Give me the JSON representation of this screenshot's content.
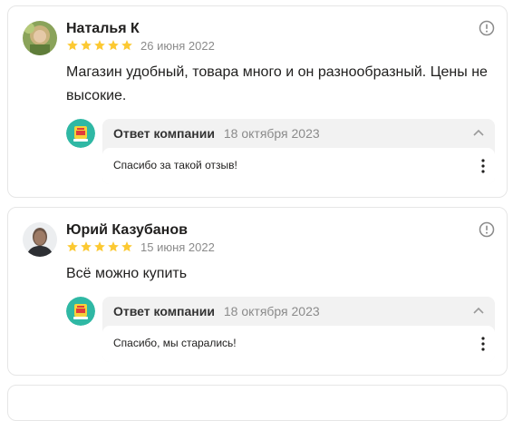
{
  "reviews": [
    {
      "author": "Наталья К",
      "rating": 5,
      "date": "26 июня 2022",
      "text": "Магазин удобный, товара много и он разнообразный. Цены не высокие.",
      "reply": {
        "title": "Ответ компании",
        "date": "18 октября 2023",
        "text": "Спасибо за такой отзыв!"
      }
    },
    {
      "author": "Юрий Казубанов",
      "rating": 5,
      "date": "15 июня 2022",
      "text": "Всё можно купить",
      "reply": {
        "title": "Ответ компании",
        "date": "18 октября 2023",
        "text": "Спасибо, мы старались!"
      }
    }
  ],
  "icons": {
    "star": "star-icon",
    "info": "info-icon",
    "collapse": "chevron-up-icon",
    "menu": "more-vertical-icon",
    "company": "company-logo"
  },
  "colors": {
    "star": "#fcc932",
    "logo_bg": "#2fb8a4",
    "reply_bg": "#f2f2f2",
    "muted": "#8b8b8b"
  }
}
